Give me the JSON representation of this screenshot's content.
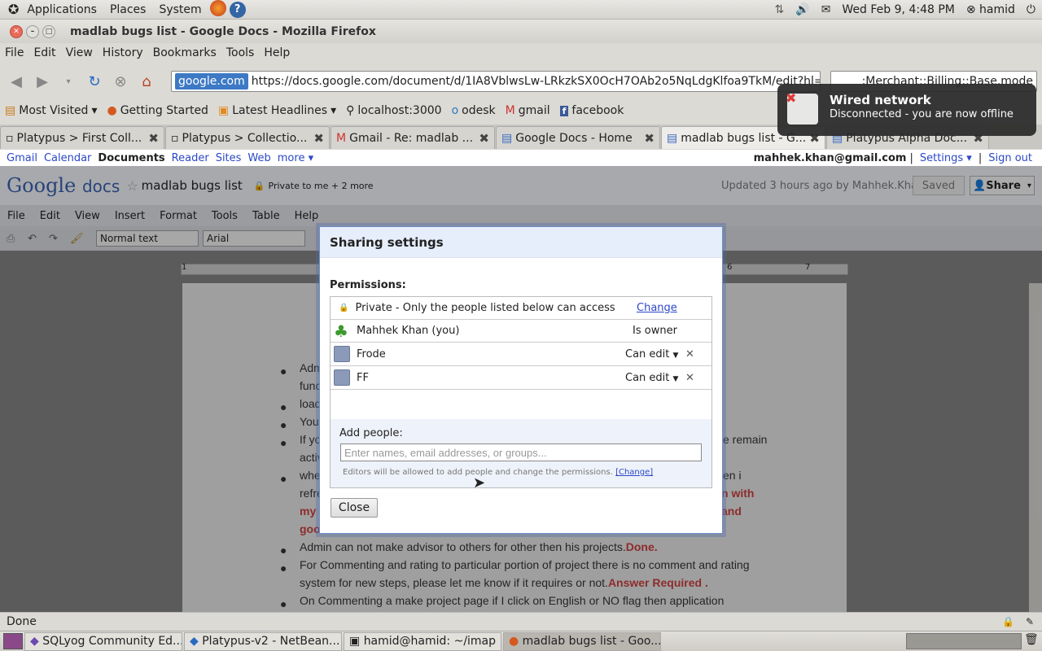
{
  "gnome_panel": {
    "menus": [
      "Applications",
      "Places",
      "System"
    ],
    "datetime": "Wed Feb  9,  4:48 PM",
    "user": "hamid"
  },
  "window": {
    "title": "madlab bugs list - Google Docs - Mozilla Firefox"
  },
  "firefox_menu": [
    "File",
    "Edit",
    "View",
    "History",
    "Bookmarks",
    "Tools",
    "Help"
  ],
  "url": {
    "site": "google.com",
    "address": "https://docs.google.com/document/d/1IA8VblwsLw-LRkzkSX0OcH7OAb2o5NqLdgKlfoa9TkM/edit?hl="
  },
  "search": {
    "value": ":Merchant::Billing::Base.mode"
  },
  "bookmarks": [
    "Most Visited",
    "Getting Started",
    "Latest Headlines",
    "localhost:3000",
    "odesk",
    "gmail",
    "facebook"
  ],
  "tabs": [
    {
      "label": "Platypus > First Coll..."
    },
    {
      "label": "Platypus > Collectio..."
    },
    {
      "label": "Gmail - Re: madlab ..."
    },
    {
      "label": "Google Docs - Home"
    },
    {
      "label": "madlab bugs list - G..."
    },
    {
      "label": "Platypus Alpha Doc..."
    }
  ],
  "gbar": {
    "links": [
      "Gmail",
      "Calendar",
      "Documents",
      "Reader",
      "Sites",
      "Web",
      "more ▾"
    ],
    "email": "mahhek.khan@gmail.com",
    "settings": "Settings ▾",
    "signout": "Sign out"
  },
  "docs": {
    "logo_google": "Google",
    "logo_docs": "docs",
    "title": "madlab bugs list",
    "privacy": "Private to me + 2 more",
    "updated": "Updated 3 hours ago by Mahhek.Khan",
    "saved": "Saved",
    "share": "Share",
    "menu": [
      "File",
      "Edit",
      "View",
      "Insert",
      "Format",
      "Tools",
      "Table",
      "Help"
    ],
    "style_select": "Normal text",
    "font_select": "Arial",
    "ruler_marks": [
      "1",
      "6",
      "7"
    ]
  },
  "doc_content": {
    "b1a": "Adm",
    "b1b": "func",
    "b2": "load",
    "b3": "You",
    "b4a": "If yo",
    "b4b": "activ",
    "b4r": "e remain",
    "b5a": "whe",
    "b5b": "refre",
    "b5r": "en i",
    "red1": "my",
    "red1r": "n with",
    "red2": "goo",
    "red2r": "and",
    "b6": "Admin can not make advisor to others for other then his projects.",
    "b6_status": "Done.",
    "b7a": "For Commenting and rating to particular portion of project there is no comment and rating",
    "b7b": "system for new steps, please let me know if it requires or not.",
    "b7_status": "Answer Required .",
    "b8": "On Commenting a make project page if I click on English or NO flag then application"
  },
  "dialog": {
    "title": "Sharing settings",
    "permissions_label": "Permissions:",
    "privacy_text": "Private - Only the people listed below can access",
    "change": "Change",
    "people": [
      {
        "name": "Mahhek Khan (you)",
        "role": "Is owner"
      },
      {
        "name": "Frode",
        "role": "Can edit"
      },
      {
        "name": "FF",
        "role": "Can edit"
      }
    ],
    "add_label": "Add people:",
    "add_placeholder": "Enter names, email addresses, or groups...",
    "editors_note": "Editors will be allowed to add people and change the permissions.",
    "editors_change": "[Change]",
    "close": "Close"
  },
  "notification": {
    "title": "Wired network",
    "body": "Disconnected - you are now offline"
  },
  "status": "Done",
  "taskbar": [
    {
      "label": "SQLyog Community Ed..."
    },
    {
      "label": "Platypus-v2 - NetBean..."
    },
    {
      "label": "hamid@hamid: ~/imap"
    },
    {
      "label": "madlab bugs list - Goo..."
    }
  ]
}
